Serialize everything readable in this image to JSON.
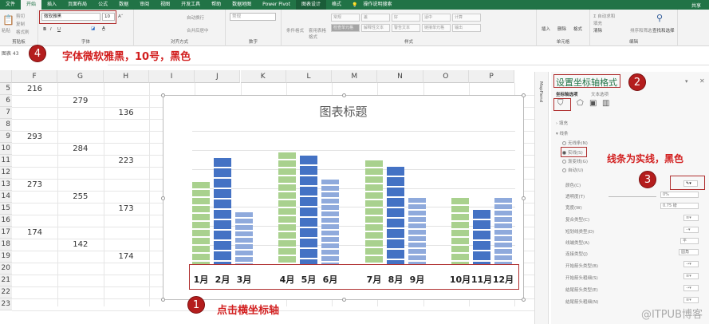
{
  "ribbon": {
    "tabs": [
      "文件",
      "开始",
      "插入",
      "页面布局",
      "公式",
      "数据",
      "审阅",
      "视图",
      "开发工具",
      "帮助",
      "数据地图",
      "Power Pivot",
      "图表设计",
      "格式"
    ],
    "active_tab": "开始",
    "search": "操作说明搜索",
    "share": "共享",
    "clipboard": {
      "label": "剪贴板",
      "paste": "粘贴",
      "cut": "剪切",
      "copy": "复制",
      "format_painter": "格式刷"
    },
    "font": {
      "label": "字体",
      "font_name": "微软雅黑",
      "font_size": "10",
      "bold": "B",
      "italic": "I",
      "underline": "U"
    },
    "alignment": {
      "label": "对齐方式",
      "wrap": "自动换行",
      "merge": "合并后居中"
    },
    "number": {
      "label": "数字",
      "format": "常规"
    },
    "styles": {
      "label": "样式",
      "conditional": "条件格式",
      "table": "套用表格格式",
      "cells": [
        "常规",
        "差",
        "好",
        "适中",
        "计算",
        "检查单元格",
        "解释性文本",
        "警告文本",
        "链接单元格",
        "输出"
      ]
    },
    "cells_group": {
      "label": "单元格",
      "insert": "插入",
      "delete": "删除",
      "format": "格式"
    },
    "editing": {
      "label": "编辑",
      "autosum": "自动求和",
      "fill": "填充",
      "clear": "清除",
      "sort": "排序和筛选",
      "find": "查找和选择"
    }
  },
  "namebox": "图表 43",
  "sheet": {
    "columns": [
      "F",
      "G",
      "H",
      "I",
      "J",
      "K",
      "L",
      "M",
      "N",
      "O",
      "P"
    ],
    "rows": [
      "5",
      "6",
      "7",
      "8",
      "9",
      "10",
      "11",
      "12",
      "13",
      "14",
      "15",
      "16",
      "17",
      "18",
      "19",
      "20",
      "21",
      "22",
      "23"
    ],
    "cells": [
      {
        "row": "5",
        "col": "F",
        "value": "216"
      },
      {
        "row": "6",
        "col": "G",
        "value": "279"
      },
      {
        "row": "7",
        "col": "H",
        "value": "136"
      },
      {
        "row": "9",
        "col": "F",
        "value": "293"
      },
      {
        "row": "10",
        "col": "G",
        "value": "284"
      },
      {
        "row": "11",
        "col": "H",
        "value": "223"
      },
      {
        "row": "13",
        "col": "F",
        "value": "273"
      },
      {
        "row": "14",
        "col": "G",
        "value": "255"
      },
      {
        "row": "15",
        "col": "H",
        "value": "173"
      },
      {
        "row": "17",
        "col": "F",
        "value": "174"
      },
      {
        "row": "18",
        "col": "G",
        "value": "142"
      },
      {
        "row": "19",
        "col": "H",
        "value": "174"
      }
    ]
  },
  "chart_data": {
    "type": "bar",
    "title": "图表标题",
    "categories": [
      "1月",
      "2月",
      "3月",
      "4月",
      "5月",
      "6月",
      "7月",
      "8月",
      "9月",
      "10月",
      "11月",
      "12月"
    ],
    "values": [
      216,
      279,
      136,
      293,
      284,
      223,
      273,
      255,
      173,
      174,
      142,
      174
    ],
    "bar_colors": [
      "#a9d18e",
      "#4472c4",
      "#8faadc"
    ],
    "ylim": [
      0,
      350
    ],
    "ytick_step": 50,
    "grid": true,
    "y_axis_labels_visible": false
  },
  "pane": {
    "strip_label": "MapFiend",
    "title": "设置坐标轴格式",
    "tab_axis_options": "坐标轴选项",
    "tab_text_options": "文本选项",
    "icons": [
      "fill-line-icon",
      "effects-icon",
      "size-properties-icon",
      "axis-options-icon"
    ],
    "section_fill": "填充",
    "section_line": "线条",
    "line_options": [
      "无线条(N)",
      "实线(S)",
      "渐变线(G)",
      "自动(U)"
    ],
    "selected_line_option": "实线(S)",
    "color_label": "颜色(C)",
    "transparency_label": "透明度(T)",
    "transparency_value": "0%",
    "width_label": "宽度(W)",
    "width_value": "0.75 磅",
    "compound_label": "复合类型(C)",
    "dash_label": "短划线类型(D)",
    "cap_label": "线端类型(A)",
    "cap_value": "平",
    "join_label": "连接类型(J)",
    "join_value": "圆角",
    "begin_arrow_type": "开始箭头类型(B)",
    "begin_arrow_size": "开始箭头粗细(S)",
    "end_arrow_type": "结尾箭头类型(E)",
    "end_arrow_size": "结尾箭头粗细(N)"
  },
  "annotations": {
    "step1": {
      "num": "1",
      "text": "点击横坐标轴"
    },
    "step2": {
      "num": "2"
    },
    "step3": {
      "num": "3",
      "text": "线条为实线，黑色"
    },
    "step4": {
      "num": "4",
      "text": "字体微软雅黑，10号，黑色"
    },
    "highlight_color": "#b03030"
  },
  "watermark": "@ITPUB博客"
}
